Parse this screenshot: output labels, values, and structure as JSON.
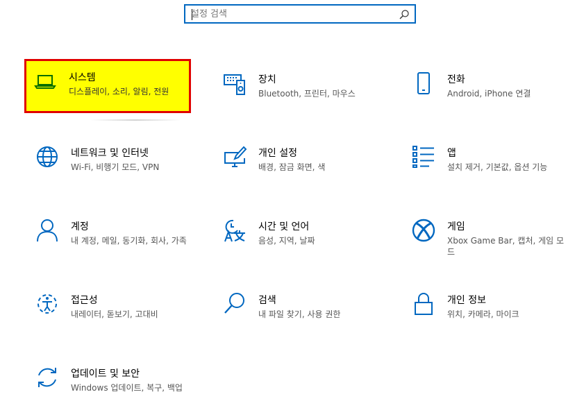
{
  "search": {
    "placeholder": "설정 검색",
    "value": ""
  },
  "colors": {
    "accent": "#0067c0",
    "selected_fill": "#ffff00",
    "selected_border": "#e00000"
  },
  "tiles": [
    {
      "title": "시스템",
      "desc": "디스플레이, 소리, 알림, 전원",
      "icon": "laptop-icon"
    },
    {
      "title": "장치",
      "desc": "Bluetooth, 프린터, 마우스",
      "icon": "devices-icon"
    },
    {
      "title": "전화",
      "desc": "Android, iPhone 연결",
      "icon": "phone-icon"
    },
    {
      "title": "네트워크 및 인터넷",
      "desc": "Wi-Fi, 비행기 모드, VPN",
      "icon": "globe-icon"
    },
    {
      "title": "개인 설정",
      "desc": "배경, 잠금 화면, 색",
      "icon": "personalization-icon"
    },
    {
      "title": "앱",
      "desc": "설치 제거, 기본값, 옵션 기능",
      "icon": "apps-list-icon"
    },
    {
      "title": "계정",
      "desc": "내 계정, 메일, 동기화, 회사, 가족",
      "icon": "person-icon"
    },
    {
      "title": "시간 및 언어",
      "desc": "음성, 지역, 날짜",
      "icon": "time-language-icon"
    },
    {
      "title": "게임",
      "desc": "Xbox Game Bar, 캡처, 게임 모드",
      "icon": "xbox-icon"
    },
    {
      "title": "접근성",
      "desc": "내레이터, 돋보기, 고대비",
      "icon": "accessibility-icon"
    },
    {
      "title": "검색",
      "desc": "내 파일 찾기, 사용 권한",
      "icon": "search-icon"
    },
    {
      "title": "개인 정보",
      "desc": "위치, 카메라, 마이크",
      "icon": "lock-icon"
    },
    {
      "title": "업데이트 및 보안",
      "desc": "Windows 업데이트, 복구, 백업",
      "icon": "sync-icon"
    }
  ]
}
